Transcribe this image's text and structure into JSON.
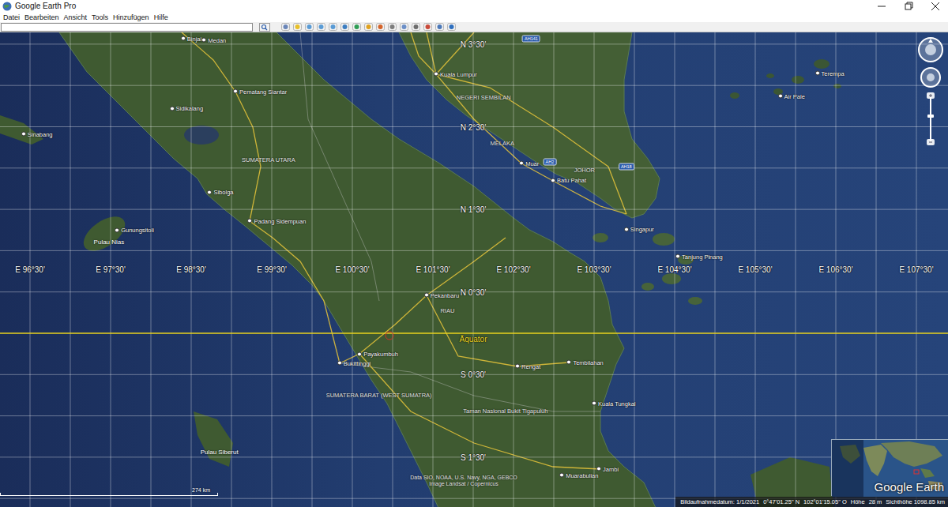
{
  "window": {
    "title": "Google Earth Pro"
  },
  "menu": [
    {
      "label": "Datei"
    },
    {
      "label": "Bearbeiten"
    },
    {
      "label": "Ansicht"
    },
    {
      "label": "Tools"
    },
    {
      "label": "Hinzufügen"
    },
    {
      "label": "Hilfe"
    }
  ],
  "search": {
    "value": ""
  },
  "map": {
    "meridians": [
      {
        "label": "E 96°30'",
        "lon": 96.5
      },
      {
        "label": "E 97°30'",
        "lon": 97.5
      },
      {
        "label": "E 98°30'",
        "lon": 98.5
      },
      {
        "label": "E 99°30'",
        "lon": 99.5
      },
      {
        "label": "E 100°30'",
        "lon": 100.5
      },
      {
        "label": "E 101°30'",
        "lon": 101.5
      },
      {
        "label": "E 102°30'",
        "lon": 102.5
      },
      {
        "label": "E 103°30'",
        "lon": 103.5
      },
      {
        "label": "E 104°30'",
        "lon": 104.5
      },
      {
        "label": "E 105°30'",
        "lon": 105.5
      },
      {
        "label": "E 106°30'",
        "lon": 106.5
      },
      {
        "label": "E 107°30'",
        "lon": 107.5
      }
    ],
    "parallels": [
      {
        "label": "N 3°30'",
        "lat": 3.5,
        "kind": "parallel"
      },
      {
        "label": "N 2°30'",
        "lat": 2.5,
        "kind": "parallel"
      },
      {
        "label": "N 1°30'",
        "lat": 1.5,
        "kind": "parallel"
      },
      {
        "label": "N 0°30'",
        "lat": 0.5,
        "kind": "parallel"
      },
      {
        "label": "Äquator",
        "lat": 0,
        "kind": "equator"
      },
      {
        "label": "S 0°30'",
        "lat": -0.5,
        "kind": "parallel"
      },
      {
        "label": "S 1°30'",
        "lat": -1.5,
        "kind": "parallel"
      }
    ],
    "places": [
      {
        "name": "Binjai",
        "lat": 3.57,
        "lon": 98.4,
        "kind": "city"
      },
      {
        "name": "Medan",
        "lat": 3.55,
        "lon": 98.66,
        "kind": "city"
      },
      {
        "name": "Pematang Siantar",
        "lat": 2.93,
        "lon": 99.05,
        "kind": "city"
      },
      {
        "name": "Sidikalang",
        "lat": 2.72,
        "lon": 98.26,
        "kind": "city"
      },
      {
        "name": "Sinabang",
        "lat": 2.41,
        "lon": 96.42,
        "kind": "city"
      },
      {
        "name": "Sibolga",
        "lat": 1.71,
        "lon": 98.73,
        "kind": "city"
      },
      {
        "name": "Padang Sidempuan",
        "lat": 1.36,
        "lon": 99.23,
        "kind": "city"
      },
      {
        "name": "Gunungsitoli",
        "lat": 1.25,
        "lon": 97.58,
        "kind": "city"
      },
      {
        "name": "Kuala Lumpur",
        "lat": 3.14,
        "lon": 101.54,
        "kind": "city"
      },
      {
        "name": "Muar",
        "lat": 2.06,
        "lon": 102.6,
        "kind": "city"
      },
      {
        "name": "Batu Pahat",
        "lat": 1.85,
        "lon": 102.99,
        "kind": "city"
      },
      {
        "name": "Singapur",
        "lat": 1.26,
        "lon": 103.9,
        "kind": "city"
      },
      {
        "name": "Tanjung Pinang",
        "lat": 0.93,
        "lon": 104.54,
        "kind": "city"
      },
      {
        "name": "Pekanbaru",
        "lat": 0.46,
        "lon": 101.42,
        "kind": "city"
      },
      {
        "name": "Payakumbuh",
        "lat": -0.25,
        "lon": 100.59,
        "kind": "city"
      },
      {
        "name": "Bukittinggi",
        "lat": -0.36,
        "lon": 100.34,
        "kind": "city"
      },
      {
        "name": "Rengat",
        "lat": -0.4,
        "lon": 102.55,
        "kind": "city"
      },
      {
        "name": "Tembilahan",
        "lat": -0.35,
        "lon": 103.19,
        "kind": "city"
      },
      {
        "name": "Kuala Tungkal",
        "lat": -0.85,
        "lon": 103.5,
        "kind": "city"
      },
      {
        "name": "Jambi",
        "lat": -1.64,
        "lon": 103.56,
        "kind": "city"
      },
      {
        "name": "Muarabulian",
        "lat": -1.72,
        "lon": 103.1,
        "kind": "city"
      },
      {
        "name": "Terempa",
        "lat": 3.15,
        "lon": 106.27,
        "kind": "city"
      },
      {
        "name": "Air Pale",
        "lat": 2.87,
        "lon": 105.81,
        "kind": "city"
      },
      {
        "name": "SUMATERA UTARA",
        "lat": 2.1,
        "lon": 99.46,
        "kind": "region"
      },
      {
        "name": "NEGERI SEMBILAN",
        "lat": 2.86,
        "lon": 102.13,
        "kind": "region"
      },
      {
        "name": "MELAKA",
        "lat": 2.3,
        "lon": 102.36,
        "kind": "region"
      },
      {
        "name": "JOHOR",
        "lat": 1.98,
        "lon": 103.38,
        "kind": "region"
      },
      {
        "name": "RIAU",
        "lat": 0.28,
        "lon": 101.68,
        "kind": "region"
      },
      {
        "name": "SUMATERA BARAT (WEST SUMATRA)",
        "lat": -0.75,
        "lon": 100.83,
        "kind": "region"
      },
      {
        "name": "Taman Nasional Bukit Tigapuluh",
        "lat": -0.94,
        "lon": 102.4,
        "kind": "region"
      },
      {
        "name": "Pulau Nias",
        "lat": 1.11,
        "lon": 97.48,
        "kind": "island"
      },
      {
        "name": "Pulau Siberut",
        "lat": -1.43,
        "lon": 98.85,
        "kind": "island"
      }
    ],
    "road_shields": [
      {
        "label": "AH141",
        "lat": 3.57,
        "lon": 102.72
      },
      {
        "label": "AH2",
        "lat": 2.07,
        "lon": 102.95
      },
      {
        "label": "AH18",
        "lat": 2.02,
        "lon": 103.9
      }
    ],
    "scale": "274 km",
    "attribution": [
      "Data SIO, NOAA, U.S. Navy, NGA, GEBCO",
      "Image Landsat / Copernicus"
    ]
  },
  "overview": {
    "logo": "Google Earth"
  },
  "status_bar": {
    "image_date": "Bildaufnahmedatum: 1/1/2021",
    "lat": "0°47'01.25\" N",
    "lon": "102°01'15.05\" O",
    "elevation_label": "Höhe",
    "elevation": "28 m",
    "eye_altitude": "Sichthöhe 1098.85 km"
  }
}
